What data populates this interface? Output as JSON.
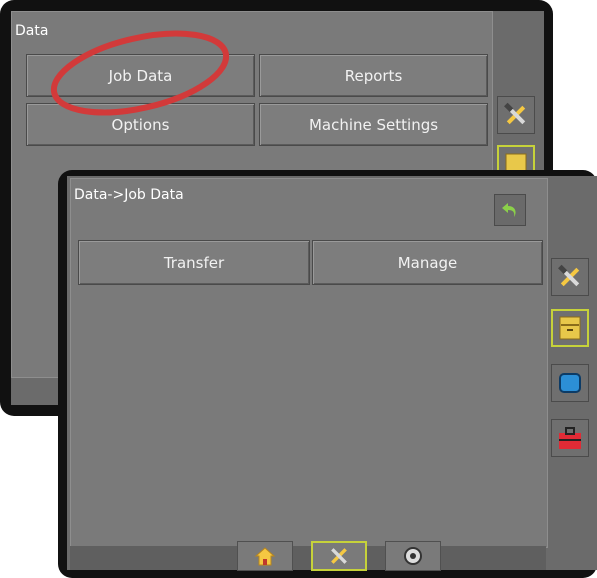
{
  "back_screen": {
    "title": "Data",
    "buttons": {
      "job_data": "Job Data",
      "reports": "Reports",
      "options": "Options",
      "machine_settings": "Machine Settings"
    }
  },
  "front_screen": {
    "title": "Data->Job Data",
    "buttons": {
      "transfer": "Transfer",
      "manage": "Manage"
    }
  },
  "side_icons": [
    "tools-icon",
    "file-drawer-icon",
    "display-icon",
    "toolbox-icon"
  ],
  "bottom_icons": [
    "home-icon",
    "tools-icon",
    "camera-icon"
  ],
  "colors": {
    "highlight_ring": "#d23a3a",
    "active_border": "#c6d23a",
    "accent_yellow": "#e8c84a",
    "accent_blue": "#2c8fd6",
    "accent_red": "#e02b36",
    "back_arrow": "#8bd04a"
  }
}
